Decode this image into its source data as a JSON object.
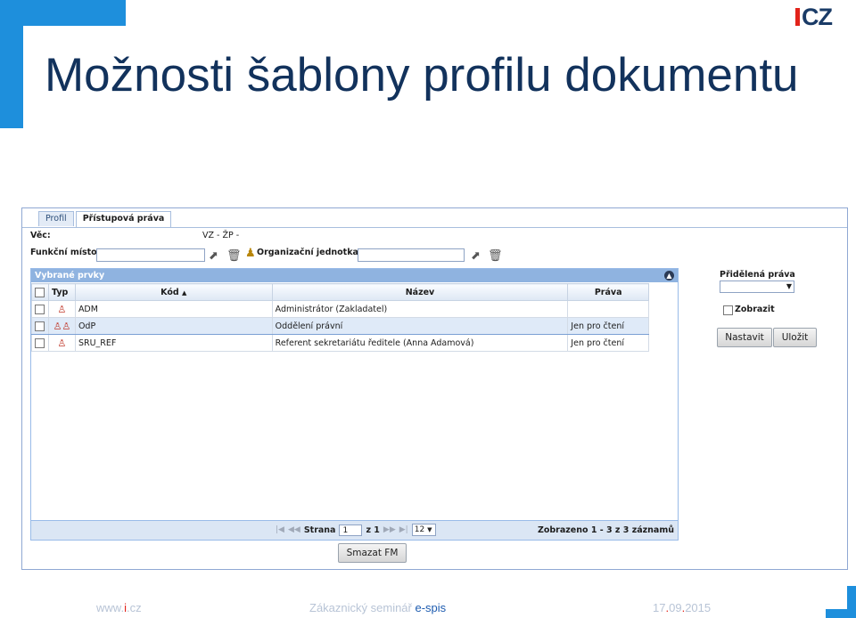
{
  "slide": {
    "title": "Možnosti šablony profilu dokumentu",
    "logo_text": "CZ",
    "footer": {
      "url_pre": "www.",
      "url_red": "i",
      "url_post": ".cz",
      "event_pre": "Zákaznický seminář ",
      "event_blue": "e-spis",
      "date_pre": "17",
      "date_dot1": ".",
      "date_mid": "09",
      "date_dot2": ".",
      "date_post": "2015"
    }
  },
  "colors": {
    "accent": "#1e8fdc",
    "brand_red": "#e2231a",
    "title": "#12325c"
  },
  "app": {
    "tabs": [
      "Profil",
      "Přístupová práva"
    ],
    "active_tab": "Přístupová práva",
    "vec_label": "Věc:",
    "vec_value": "VZ - ŽP -",
    "funkcni_misto_label": "Funkční místo:",
    "funkcni_misto_value": "",
    "org_jednotka_label": "Organizační jednotka:",
    "org_jednotka_value": "",
    "grid": {
      "title": "Vybrané prvky",
      "columns": [
        "Typ",
        "Kód",
        "Název",
        "Práva"
      ],
      "rows": [
        {
          "kod": "ADM",
          "nazev": "Administrátor (Zakladatel)",
          "prava": "",
          "selected": false,
          "type_icon": "person-icon"
        },
        {
          "kod": "OdP",
          "nazev": "Oddělení právní",
          "prava": "Jen pro čtení",
          "selected": true,
          "type_icon": "group-icon"
        },
        {
          "kod": "SRU_REF",
          "nazev": "Referent sekretariátu ředitele (Anna Adamová)",
          "prava": "Jen pro čtení",
          "selected": false,
          "type_icon": "person-icon"
        }
      ],
      "pager": {
        "strana_label": "Strana",
        "page": "1",
        "of_label": "z 1",
        "page_size": "12",
        "shown": "Zobrazeno 1 - 3 z 3 záznamů"
      }
    },
    "pridelena_prava_label": "Přidělená práva",
    "pridelena_prava_value": "",
    "zobrazit_label": "Zobrazit",
    "zobrazit_checked": false,
    "nastavit_label": "Nastavit",
    "ulozit_label": "Uložit",
    "smazat_label": "Smazat FM"
  }
}
